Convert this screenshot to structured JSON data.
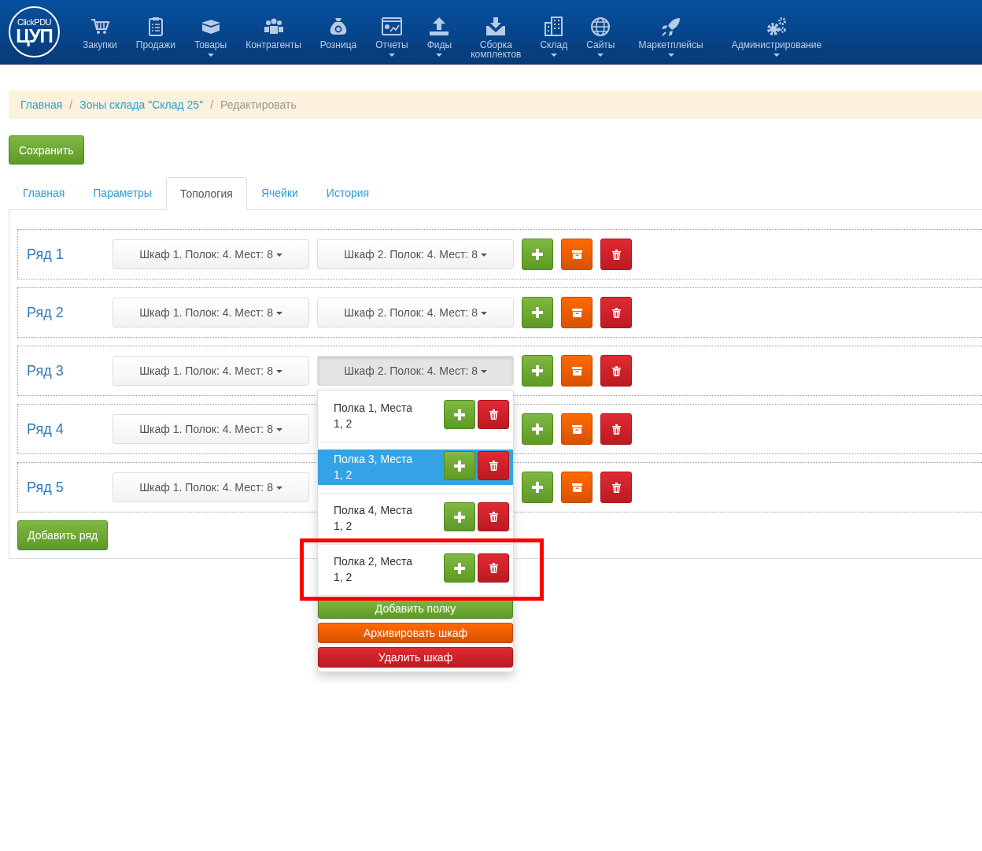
{
  "logo": {
    "top": "ClickPDU",
    "main": "ЦУП"
  },
  "nav": [
    {
      "label": "Закупки",
      "has_menu": false
    },
    {
      "label": "Продажи",
      "has_menu": false
    },
    {
      "label": "Товары",
      "has_menu": true
    },
    {
      "label": "Контрагенты",
      "has_menu": false
    },
    {
      "label": "Розница",
      "has_menu": false
    },
    {
      "label": "Отчеты",
      "has_menu": true
    },
    {
      "label": "Фиды",
      "has_menu": true
    },
    {
      "label": "Сборка комплектов",
      "has_menu": false
    },
    {
      "label": "Склад",
      "has_menu": true
    },
    {
      "label": "Сайты",
      "has_menu": true
    },
    {
      "label": "Маркетплейсы",
      "has_menu": true
    },
    {
      "label": "Администрирование",
      "has_menu": true
    }
  ],
  "breadcrumb_separator": "/",
  "breadcrumb": [
    {
      "label": "Главная",
      "link": true
    },
    {
      "label": "Зоны склада \"Склад 25\"",
      "link": true
    },
    {
      "label": "Редактировать",
      "link": false
    }
  ],
  "save_button": "Сохранить",
  "tabs": [
    {
      "label": "Главная",
      "selected": false
    },
    {
      "label": "Параметры",
      "selected": false
    },
    {
      "label": "Топология",
      "selected": true
    },
    {
      "label": "Ячейки",
      "selected": false
    },
    {
      "label": "История",
      "selected": false
    }
  ],
  "rows": [
    {
      "label": "Ряд 1",
      "cabinets": [
        {
          "label": "Шкаф 1. Полок: 4. Мест: 8",
          "open": false
        },
        {
          "label": "Шкаф 2. Полок: 4. Мест: 8",
          "open": false
        }
      ]
    },
    {
      "label": "Ряд 2",
      "cabinets": [
        {
          "label": "Шкаф 1. Полок: 4. Мест: 8",
          "open": false
        },
        {
          "label": "Шкаф 2. Полок: 4. Мест: 8",
          "open": false
        }
      ]
    },
    {
      "label": "Ряд 3",
      "cabinets": [
        {
          "label": "Шкаф 1. Полок: 4. Мест: 8",
          "open": false
        },
        {
          "label": "Шкаф 2. Полок: 4. Мест: 8",
          "open": true
        }
      ]
    },
    {
      "label": "Ряд 4",
      "cabinets": [
        {
          "label": "Шкаф 1. Полок: 4. Мест: 8",
          "open": false
        }
      ]
    },
    {
      "label": "Ряд 5",
      "cabinets": [
        {
          "label": "Шкаф 1. Полок: 4. Мест: 8",
          "open": false
        }
      ]
    }
  ],
  "add_row_button": "Добавить ряд",
  "dropdown": {
    "shelves": [
      {
        "label": "Полка 1, Места 1, 2",
        "selected": false,
        "highlighted": false
      },
      {
        "label": "Полка 3, Места 1, 2",
        "selected": true,
        "highlighted": false
      },
      {
        "label": "Полка 4, Места 1, 2",
        "selected": false,
        "highlighted": false
      },
      {
        "label": "Полка 2, Места 1, 2",
        "selected": false,
        "highlighted": true
      }
    ],
    "actions": [
      {
        "label": "Добавить полку",
        "kind": "add"
      },
      {
        "label": "Архивировать шкаф",
        "kind": "archive"
      },
      {
        "label": "Удалить шкаф",
        "kind": "delete"
      }
    ]
  }
}
